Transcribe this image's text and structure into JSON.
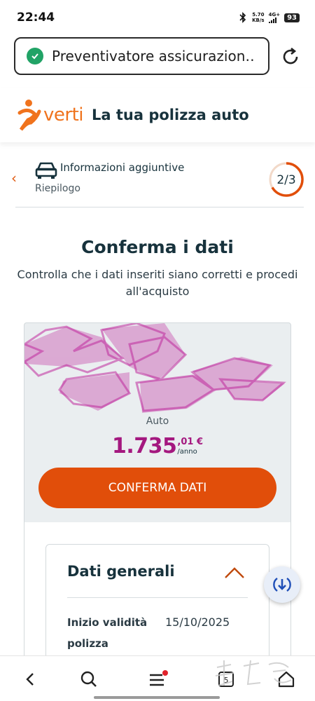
{
  "status_bar": {
    "time": "22:44",
    "speed_value": "5.70",
    "speed_unit": "KB/s",
    "network": "4G+",
    "battery": "93"
  },
  "browser": {
    "url_title": "Preventivatore assicurazion…",
    "tab_count": "5"
  },
  "site": {
    "logo_text": "verti",
    "header_title": "La tua polizza auto"
  },
  "steps": {
    "current_step": "Informazioni aggiuntive",
    "next_step": "Riepilogo",
    "progress_label": "2/3",
    "progress_fraction": 0.6667
  },
  "main": {
    "title": "Conferma i dati",
    "subtitle": "Controlla che i dati inseriti siano corretti e procedi all'acquisto"
  },
  "summary": {
    "product": "Auto",
    "price_main": "1.735",
    "price_decimal": ",01 €",
    "price_unit": "/anno",
    "confirm_label": "CONFERMA DATI"
  },
  "details": {
    "section_title": "Dati generali",
    "rows": [
      {
        "label": "Inizio validità polizza",
        "value": "15/10/2025"
      }
    ]
  },
  "colors": {
    "brand_orange": "#e14e0a",
    "price_magenta": "#a4187f",
    "dark_text": "#17323c",
    "secure_green": "#21a366"
  },
  "icons": {
    "secure": "shield-check-icon",
    "reload": "reload-icon",
    "back": "chevron-left-icon",
    "car": "car-icon",
    "collapse": "chevron-up-icon",
    "download": "download-icon"
  }
}
